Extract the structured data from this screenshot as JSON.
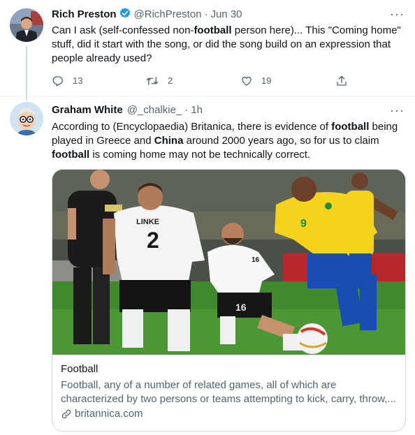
{
  "tweet1": {
    "name": "Rich Preston",
    "handle": "@RichPreston",
    "separator": "·",
    "time": "Jun 30",
    "text_parts": [
      "Can I ask (self-confessed non-",
      "football",
      " person here)... This \"Coming home\" stuff, did it start with the song, or did the song build on an expression that people already used?"
    ],
    "replies": "13",
    "retweets": "2",
    "likes": "19",
    "more_icon": "more-dots-icon"
  },
  "tweet2": {
    "name": "Graham White",
    "handle": "@_chalkie_",
    "separator": "·",
    "time": "1h",
    "text_parts": [
      "According to (Encyclopaedia) Britanica, there is evidence of ",
      "football",
      " being played in Greece and ",
      "China",
      " around 2000 years ago, so for us to claim ",
      "football",
      " is coming home may not be technically correct."
    ],
    "card": {
      "title": "Football",
      "description": "Football, any of a number of related games, all of which are characterized by two persons or teams attempting to kick, carry, throw,...",
      "domain": "britannica.com",
      "image_player_left_shirt": "LINKE 2",
      "image_player_mid_shirt": "16",
      "image_player_right_shirt": "9"
    }
  },
  "colors": {
    "text": "#0f1419",
    "secondary": "#536471",
    "verified": "#1d9bf0",
    "border": "#cfd9de",
    "pitch": "#3f8a2c",
    "brazil_yellow": "#f4d31c",
    "brazil_blue": "#1a4db0"
  }
}
